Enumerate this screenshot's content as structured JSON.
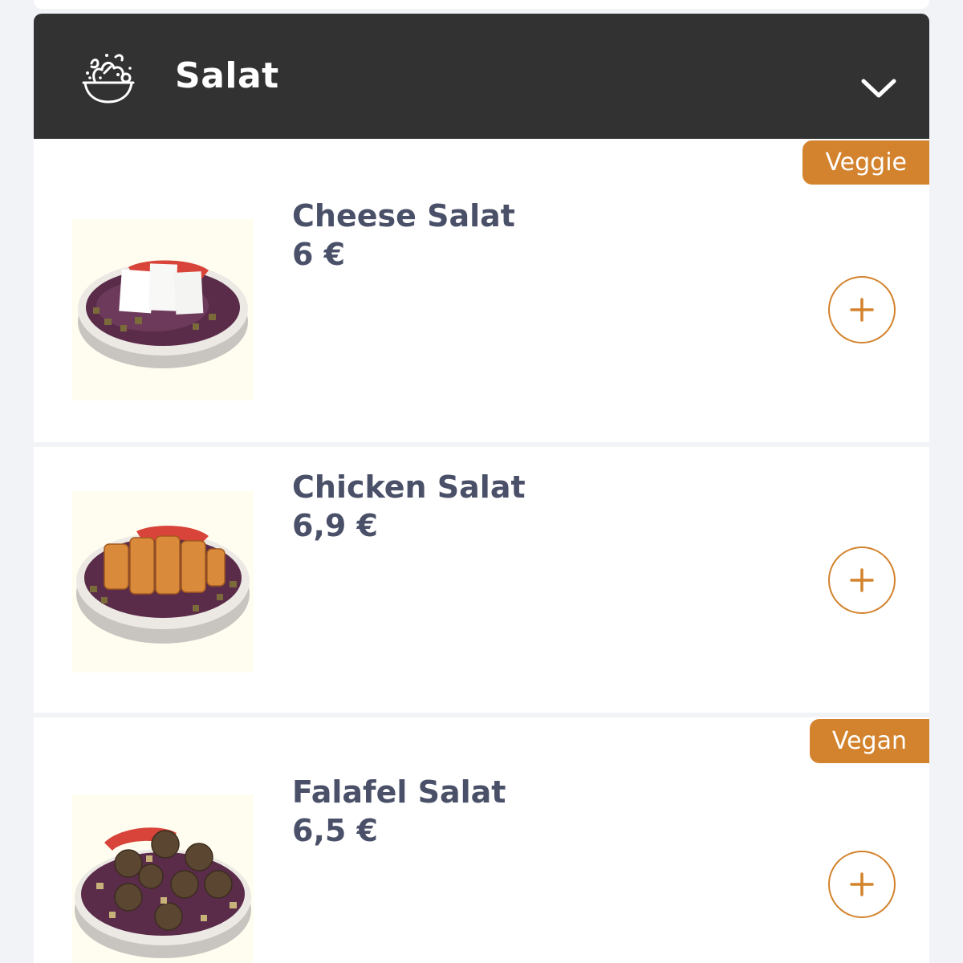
{
  "category": {
    "title": "Salat",
    "icon": "salad-bowl-icon",
    "toggle_icon": "chevron-down-icon"
  },
  "theme": {
    "header_bg": "#323232",
    "accent": "#d3832d",
    "text": "#4a5068",
    "page_bg": "#f2f3f7"
  },
  "items": [
    {
      "name": "Cheese Salat",
      "price": "6 €",
      "badge": "Veggie",
      "image": "cheese-salad-image",
      "add_icon": "plus-icon"
    },
    {
      "name": "Chicken Salat",
      "price": "6,9 €",
      "badge": "",
      "image": "chicken-salad-image",
      "add_icon": "plus-icon"
    },
    {
      "name": "Falafel Salat",
      "price": "6,5 €",
      "badge": "Vegan",
      "image": "falafel-salad-image",
      "add_icon": "plus-icon"
    }
  ]
}
